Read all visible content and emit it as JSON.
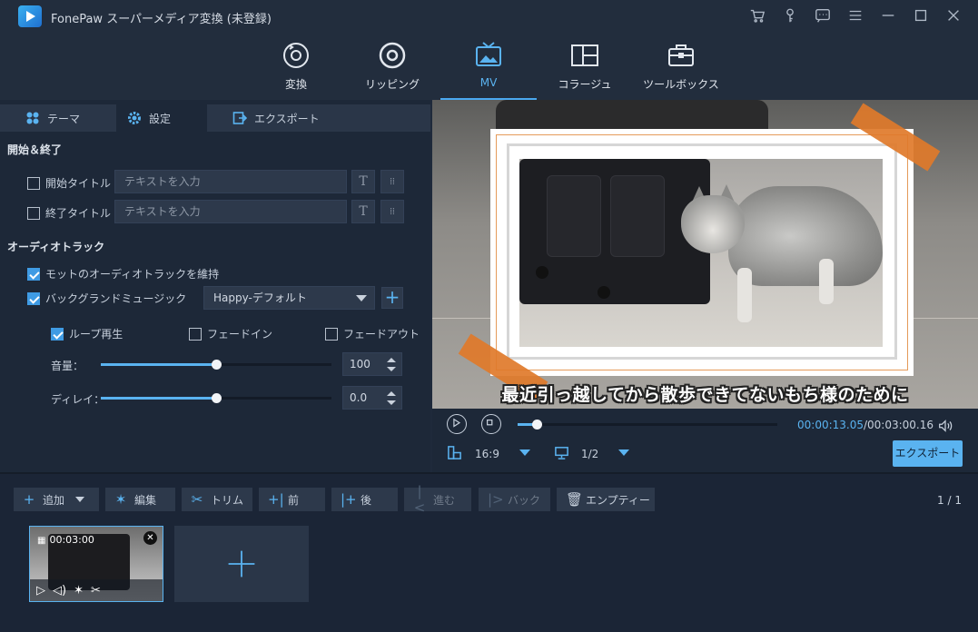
{
  "window": {
    "title": "FonePaw スーパーメディア変換 (未登録)"
  },
  "main_nav": [
    {
      "label": "変換"
    },
    {
      "label": "リッピング"
    },
    {
      "label": "MV"
    },
    {
      "label": "コラージュ"
    },
    {
      "label": "ツールボックス"
    }
  ],
  "sub_tabs": [
    {
      "label": "テーマ"
    },
    {
      "label": "設定"
    },
    {
      "label": "エクスポート"
    }
  ],
  "start_end": {
    "section_title": "開始＆終了",
    "start_title_label": "開始タイトル",
    "end_title_label": "終了タイトル",
    "start_placeholder": "テキストを入力",
    "end_placeholder": "テキストを入力",
    "font_btn": "T"
  },
  "audio": {
    "section_title": "オーディオトラック",
    "keep_original_label": "モットのオーディオトラックを維持",
    "bgm_label": "バックグランドミュージック",
    "bgm_selected": "Happy-デフォルト",
    "loop_label": "ループ再生",
    "fade_in_label": "フェードイン",
    "fade_out_label": "フェードアウト",
    "volume_label": "音量：",
    "volume_value": "100",
    "volume_level": 0.5,
    "delay_label": "ディレイ：",
    "delay_value": "0.0",
    "delay_level": 0.5
  },
  "preview": {
    "subtitle": "最近引っ越してから散歩できてないもち様のために"
  },
  "player": {
    "current_time": "00:00:13.05",
    "total_time": "/00:03:00.16",
    "progress": 0.072,
    "aspect_ratio": "16:9",
    "quality": "1/2",
    "export_label": "エクスポート"
  },
  "toolbar": {
    "add_label": "追加",
    "edit_label": "編集",
    "trim_label": "トリム",
    "before_label": "前",
    "after_label": "後",
    "forward_label": "進む",
    "back_label": "バック",
    "empty_label": "エンプティー",
    "page": "1 / 1"
  },
  "clip": {
    "duration": "00:03:00"
  },
  "colors": {
    "accent": "#5ab3f0",
    "tape": "#e0792a",
    "background": "#1f2a3b"
  }
}
